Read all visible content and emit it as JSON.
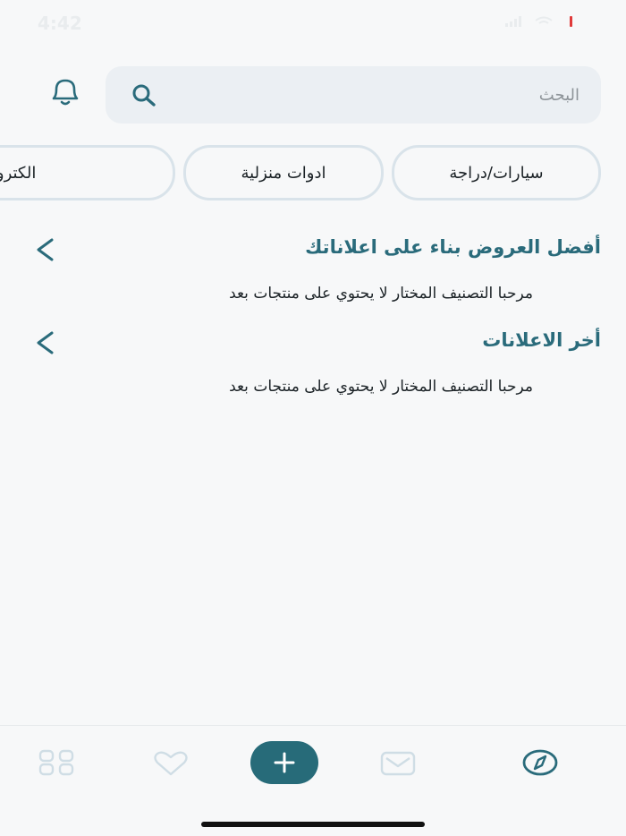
{
  "status_bar": {
    "time": "4:42"
  },
  "search": {
    "placeholder": "البحث"
  },
  "categories": [
    {
      "label": "سيارات/دراجة"
    },
    {
      "label": "ادوات منزلية"
    },
    {
      "label": "الكترونيات"
    }
  ],
  "sections": [
    {
      "title": "أفضل العروض بناء على اعلاناتك",
      "empty_message": "مرحبا التصنيف المختار لا يحتوي على منتجات بعد"
    },
    {
      "title": "أخر الاعلانات",
      "empty_message": "مرحبا التصنيف المختار لا يحتوي على منتجات بعد"
    }
  ],
  "bottom_nav": {
    "items": [
      "grid-icon",
      "heart-icon",
      "add-button",
      "mail-icon",
      "compass-icon"
    ]
  },
  "colors": {
    "accent": "#276b79",
    "title": "#2a6b7b",
    "chip_border": "#d9e3ea",
    "search_bg": "#ebeff3"
  }
}
